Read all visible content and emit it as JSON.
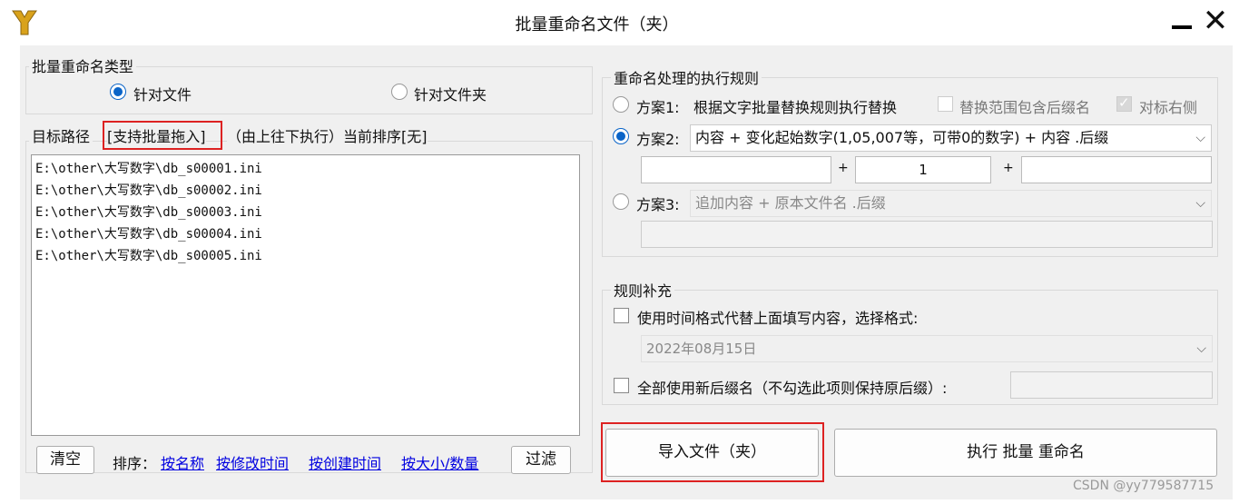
{
  "window": {
    "title": "批量重命名文件（夹）",
    "minimize_glyph": "—",
    "close_glyph": "✕"
  },
  "type_group": {
    "legend": "批量重命名类型",
    "option_file": "针对文件",
    "option_folder": "针对文件夹",
    "selected": "file"
  },
  "target": {
    "label_prefix": "目标路径",
    "label_drag": "[支持批量拖入]",
    "label_suffix": "（由上往下执行）当前排序[无]",
    "paths": [
      "E:\\other\\大写数字\\db_s00001.ini",
      "E:\\other\\大写数字\\db_s00002.ini",
      "E:\\other\\大写数字\\db_s00003.ini",
      "E:\\other\\大写数字\\db_s00004.ini",
      "E:\\other\\大写数字\\db_s00005.ini"
    ]
  },
  "bottom_bar": {
    "clear_label": "清空",
    "sort_label": "排序：",
    "sort_by_name": "按名称",
    "sort_by_modified": "按修改时间",
    "sort_by_created": "按创建时间",
    "sort_by_size": "按大小/数量",
    "filter_label": "过滤"
  },
  "rules": {
    "legend": "重命名处理的执行规则",
    "plan1_label": "方案1:",
    "plan1_text": "根据文字批量替换规则执行替换",
    "plan1_include_ext": "替换范围包含后缀名",
    "plan1_right_align": "对标右侧",
    "plan2_label": "方案2:",
    "plan2_select": "内容 + 变化起始数字(1,05,007等，可带0的数字) + 内容 .后缀",
    "plan2_prefix_value": "",
    "plan2_plus1": "+",
    "plan2_start_number": "1",
    "plan2_plus2": "+",
    "plan2_suffix_value": "",
    "plan3_label": "方案3:",
    "plan3_select": "追加内容 + 原本文件名 .后缀",
    "plan3_value": "",
    "selected_plan": 2
  },
  "supplement": {
    "legend": "规则补充",
    "use_time_label": "使用时间格式代替上面填写内容，选择格式:",
    "time_format": "2022年08月15日",
    "new_ext_label": "全部使用新后缀名（不勾选此项则保持原后缀）:",
    "new_ext_value": ""
  },
  "actions": {
    "import_label": "导入文件（夹）",
    "execute_label": "执行 批量 重命名"
  },
  "watermark": "CSDN @yy779587715",
  "colors": {
    "accent": "#0a64c8",
    "highlight_border": "#dd2222",
    "link": "#0000e0"
  }
}
